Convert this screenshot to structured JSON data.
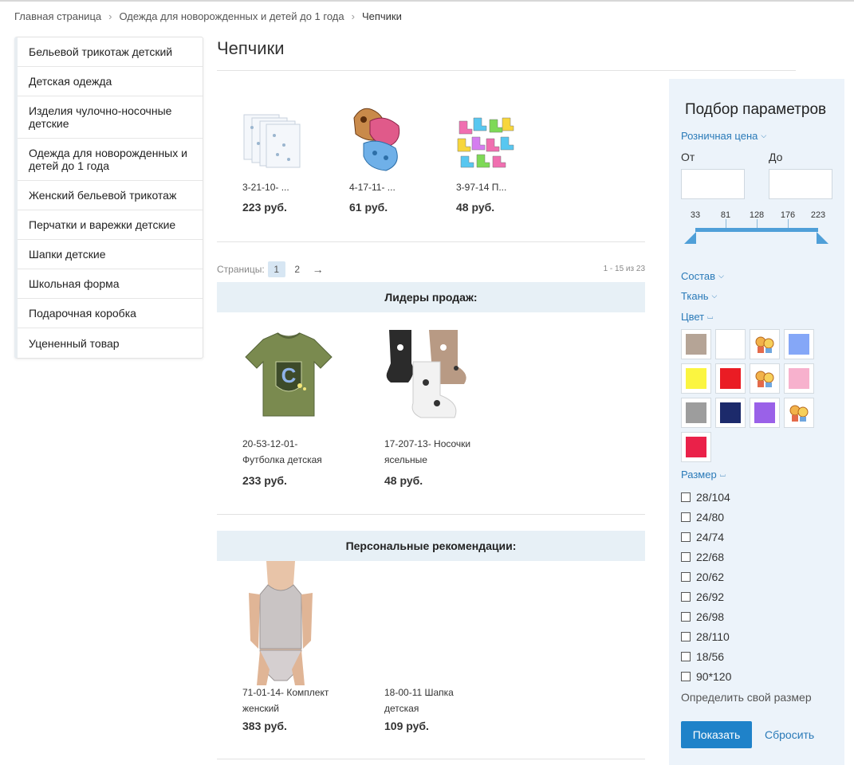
{
  "breadcrumb": {
    "items": [
      "Главная страница",
      "Одежда для новорожденных и детей до 1 года",
      "Чепчики"
    ]
  },
  "menu": {
    "items": [
      "Бельевой трикотаж детский",
      "Детская одежда",
      "Изделия чулочно-носочные детские",
      "Одежда для новорожденных и детей до 1 года",
      "Женский бельевой трикотаж",
      "Перчатки и варежки детские",
      "Шапки детские",
      "Школьная форма",
      "Подарочная коробка",
      "Уцененный товар"
    ]
  },
  "page": {
    "title": "Чепчики"
  },
  "catalog": {
    "products": [
      {
        "name": "3-21-10- ...",
        "price": "223 руб."
      },
      {
        "name": "4-17-11- ...",
        "price": "61 руб."
      },
      {
        "name": "3-97-14 П...",
        "price": "48 руб."
      }
    ]
  },
  "pagination": {
    "label": "Страницы:",
    "pages": [
      "1",
      "2"
    ],
    "next": "→",
    "count": "1 - 15 из 23"
  },
  "bestsellers": {
    "title": "Лидеры продаж:",
    "products": [
      {
        "name_line1": "20-53-12-01-",
        "name_line2": "Футболка детская",
        "price": "233 руб."
      },
      {
        "name_line1": "17-207-13- Носочки",
        "name_line2": "ясельные",
        "price": "48 руб."
      }
    ]
  },
  "recommendations": {
    "title": "Персональные рекомендации:",
    "products": [
      {
        "name_line1": "71-01-14- Комплект",
        "name_line2": "женский",
        "price": "383 руб."
      },
      {
        "name_line1": "18-00-11 Шапка",
        "name_line2": "детская",
        "price": "109 руб."
      }
    ]
  },
  "filter": {
    "title": "Подбор параметров",
    "price_label": "Розничная цена",
    "from_label": "От",
    "to_label": "До",
    "ticks": [
      "33",
      "81",
      "128",
      "176",
      "223"
    ],
    "composition": "Состав",
    "fabric": "Ткань",
    "color": "Цвет",
    "colors": [
      "#b5a496",
      "#ffffff",
      "pattern",
      "#85a7f7",
      "#fbf540",
      "#ea1c24",
      "pattern",
      "#f7b1cd",
      "#9d9d9d",
      "#1c2a6b",
      "#9a61e8",
      "pattern",
      "#ea2149"
    ],
    "size_label": "Размер",
    "sizes": [
      "28/104",
      "24/80",
      "24/74",
      "22/68",
      "20/62",
      "26/92",
      "26/98",
      "28/110",
      "18/56",
      "90*120"
    ],
    "find_size": "Определить свой размер",
    "show_button": "Показать",
    "reset_link": "Сбросить"
  }
}
